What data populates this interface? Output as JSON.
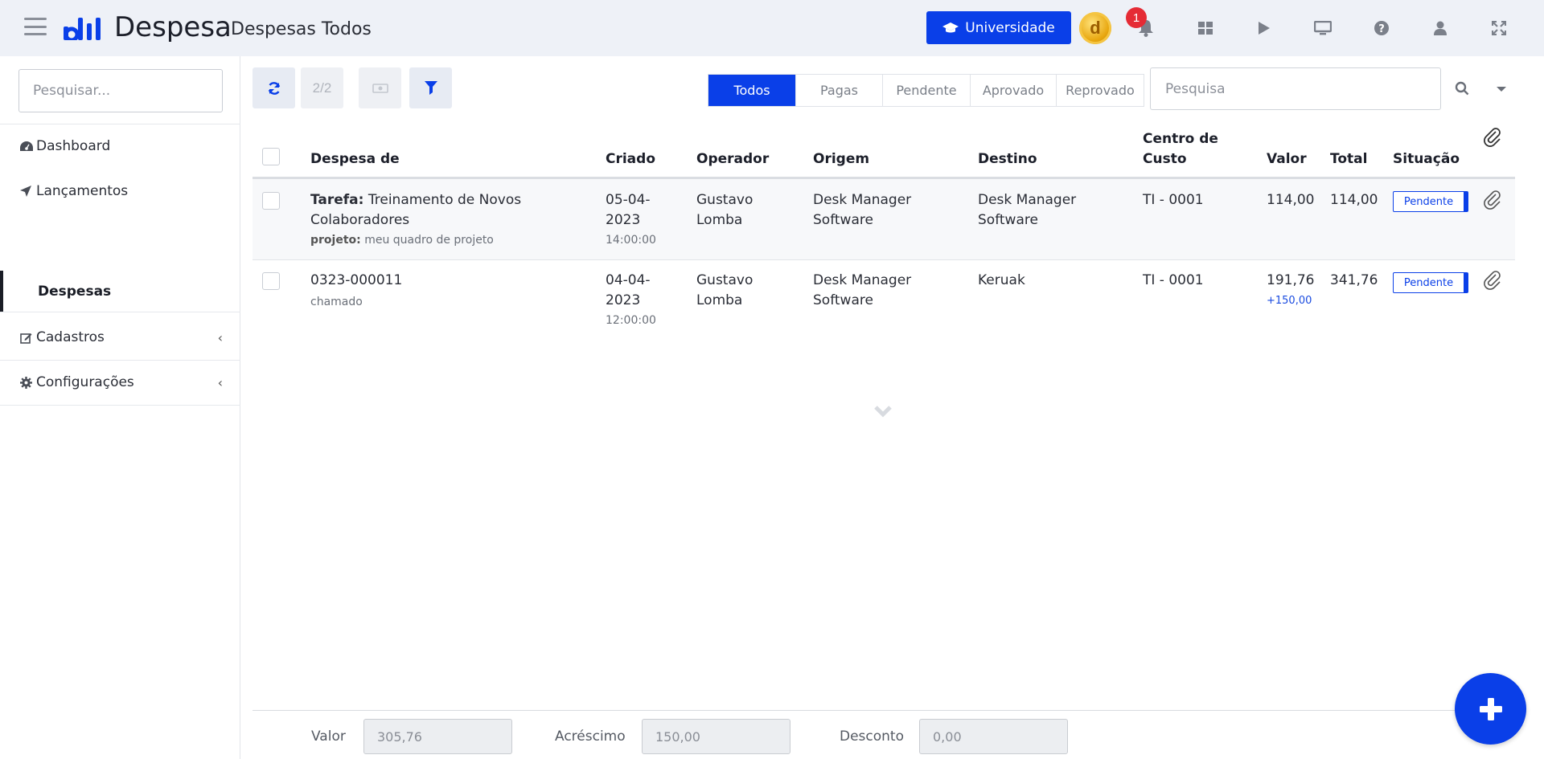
{
  "app": {
    "title": "Despesa",
    "subtitle": "Despesas Todos"
  },
  "header": {
    "university_label": "Universidade",
    "notification_count": "1",
    "icons": [
      "menu-icon",
      "logo-icon",
      "graduation-cap-icon",
      "coin-icon",
      "bell-icon",
      "grid-icon",
      "play-icon",
      "monitor-icon",
      "help-icon",
      "user-icon",
      "fullscreen-icon"
    ]
  },
  "sidebar": {
    "search_placeholder": "Pesquisar...",
    "items": [
      {
        "label": "Dashboard",
        "icon": "dashboard-icon"
      },
      {
        "label": "Lançamentos",
        "icon": "location-arrow-icon"
      },
      {
        "label": "Despesas",
        "active": true
      },
      {
        "label": "Cadastros",
        "icon": "edit-icon"
      },
      {
        "label": "Configurações",
        "icon": "gear-icon"
      }
    ]
  },
  "toolbar": {
    "pagination": "2/2",
    "tabs": [
      "Todos",
      "Pagas",
      "Pendente",
      "Aprovado",
      "Reprovado"
    ],
    "active_tab": "Todos",
    "search_placeholder": "Pesquisa"
  },
  "table": {
    "columns": {
      "despesa_de": "Despesa de",
      "criado": "Criado",
      "operador": "Operador",
      "origem": "Origem",
      "destino": "Destino",
      "centro_line1": "Centro de",
      "centro_line2": "Custo",
      "valor": "Valor",
      "total": "Total",
      "situacao": "Situação"
    },
    "rows": [
      {
        "title_prefix": "Tarefa:",
        "title_line1": "Treinamento de Novos",
        "title_line2": "Colaboradores",
        "sub_prefix": "projeto:",
        "sub": "meu quadro de projeto",
        "date_line1": "05-04-",
        "date_line2": "2023",
        "time": "14:00:00",
        "operador_line1": "Gustavo",
        "operador_line2": "Lomba",
        "origem_line1": "Desk Manager",
        "origem_line2": "Software",
        "destino_line1": "Desk Manager",
        "destino_line2": "Software",
        "centro": "TI - 0001",
        "valor": "114,00",
        "extra": "",
        "total": "114,00",
        "status": "Pendente"
      },
      {
        "title_prefix": "",
        "title_line1": "0323-000011",
        "title_line2": "",
        "sub_prefix": "",
        "sub": "chamado",
        "date_line1": "04-04-",
        "date_line2": "2023",
        "time": "12:00:00",
        "operador_line1": "Gustavo",
        "operador_line2": "Lomba",
        "origem_line1": "Desk Manager",
        "origem_line2": "Software",
        "destino_line1": "Keruak",
        "destino_line2": "",
        "centro": "TI - 0001",
        "valor": "191,76",
        "extra": "+150,00",
        "total": "341,76",
        "status": "Pendente"
      }
    ]
  },
  "footer": {
    "valor_label": "Valor",
    "valor": "305,76",
    "acrescimo_label": "Acréscimo",
    "acrescimo": "150,00",
    "desconto_label": "Desconto",
    "desconto": "0,00"
  },
  "colors": {
    "accent": "#0a3fe8",
    "badge": "#e52b35",
    "topbar_bg": "#eef1f7"
  }
}
